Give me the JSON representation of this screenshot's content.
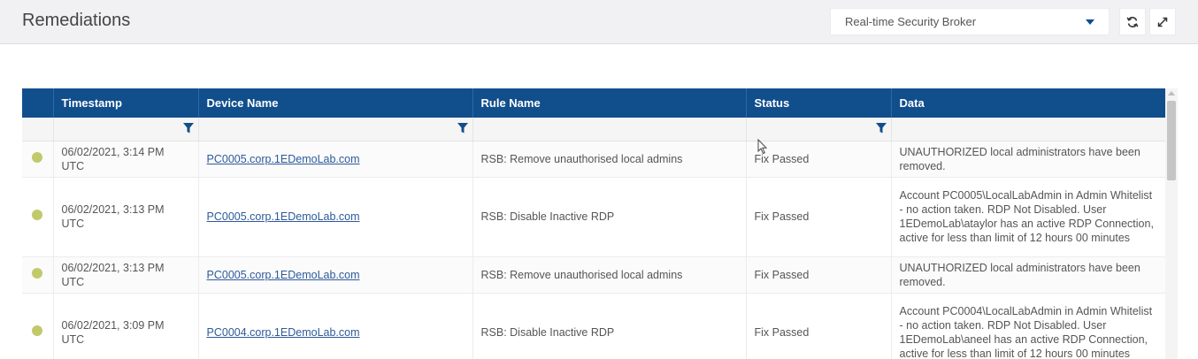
{
  "header": {
    "title": "Remediations",
    "broker_select": {
      "value": "Real-time Security Broker"
    }
  },
  "toolbar": {
    "refresh_icon": "refresh-icon",
    "expand_icon": "expand-icon"
  },
  "table": {
    "columns": [
      "",
      "Timestamp",
      "Device Name",
      "Rule Name",
      "Status",
      "Data"
    ],
    "rows": [
      {
        "timestamp": "06/02/2021, 3:14 PM UTC",
        "device": "PC0005.corp.1EDemoLab.com",
        "rule": "RSB: Remove unauthorised local admins",
        "status": "Fix Passed",
        "data": "UNAUTHORIZED local administrators have been removed."
      },
      {
        "timestamp": "06/02/2021, 3:13 PM UTC",
        "device": "PC0005.corp.1EDemoLab.com",
        "rule": "RSB: Disable Inactive RDP",
        "status": "Fix Passed",
        "data": "Account PC0005\\LocalLabAdmin in Admin Whitelist - no action taken. RDP Not Disabled. User 1EDemoLab\\ataylor has an active RDP Connection, active for less than limit of 12 hours 00 minutes"
      },
      {
        "timestamp": "06/02/2021, 3:13 PM UTC",
        "device": "PC0005.corp.1EDemoLab.com",
        "rule": "RSB: Remove unauthorised local admins",
        "status": "Fix Passed",
        "data": "UNAUTHORIZED local administrators have been removed."
      },
      {
        "timestamp": "06/02/2021, 3:09 PM UTC",
        "device": "PC0004.corp.1EDemoLab.com",
        "rule": "RSB: Disable Inactive RDP",
        "status": "Fix Passed",
        "data": "Account PC0004\\LocalLabAdmin in Admin Whitelist - no action taken. RDP Not Disabled. User 1EDemoLab\\aneel has an active RDP Connection, active for less than limit of 12 hours 00 minutes"
      }
    ]
  },
  "colors": {
    "header_bg": "#114e8c",
    "status_dot": "#c2c96a",
    "link": "#2d5a9a"
  }
}
